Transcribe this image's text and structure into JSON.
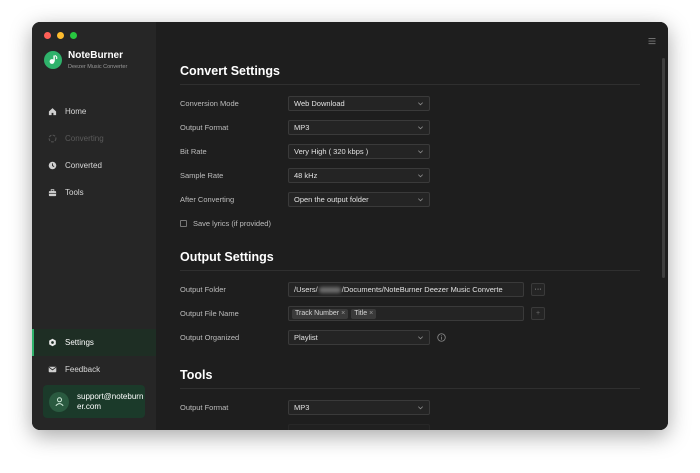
{
  "app": {
    "name": "NoteBurner",
    "subtitle": "Deezer Music Converter"
  },
  "sidebar": {
    "items": [
      {
        "label": "Home",
        "icon": "home-icon"
      },
      {
        "label": "Converting",
        "icon": "converting-icon",
        "disabled": true
      },
      {
        "label": "Converted",
        "icon": "clock-icon"
      },
      {
        "label": "Tools",
        "icon": "toolbox-icon"
      }
    ],
    "bottom_items": [
      {
        "label": "Settings",
        "icon": "settings-icon",
        "active": true
      },
      {
        "label": "Feedback",
        "icon": "mail-icon"
      }
    ],
    "support_email": "support@noteburner.com"
  },
  "convert_settings": {
    "title": "Convert Settings",
    "conversion_mode": {
      "label": "Conversion Mode",
      "value": "Web Download"
    },
    "output_format": {
      "label": "Output Format",
      "value": "MP3"
    },
    "bit_rate": {
      "label": "Bit Rate",
      "value": "Very High ( 320 kbps )"
    },
    "sample_rate": {
      "label": "Sample Rate",
      "value": "48 kHz"
    },
    "after_converting": {
      "label": "After Converting",
      "value": "Open the output folder"
    },
    "save_lyrics": {
      "label": "Save lyrics (if provided)",
      "checked": false
    }
  },
  "output_settings": {
    "title": "Output Settings",
    "output_folder": {
      "label": "Output Folder",
      "value_start": "/Users/",
      "value_end": "/Documents/NoteBurner Deezer Music Converte",
      "browse_label": "···"
    },
    "output_file_name": {
      "label": "Output File Name",
      "tags": [
        "Track Number",
        "Title"
      ],
      "add_label": "+"
    },
    "output_organized": {
      "label": "Output Organized",
      "value": "Playlist"
    }
  },
  "tools": {
    "title": "Tools",
    "output_format": {
      "label": "Output Format",
      "value": "MP3"
    }
  },
  "colors": {
    "accent": "#2fb26b",
    "background": "#1e1e1e",
    "sidebar": "#262626"
  }
}
